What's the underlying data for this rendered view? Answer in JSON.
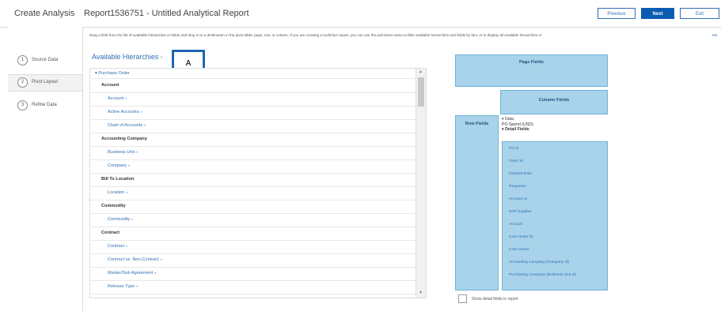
{
  "header": {
    "app_title": "Create Analysis",
    "report_title": "Report1536751 - Untitled Analytical Report",
    "previous_label": "Previous",
    "next_label": "Next",
    "exit_label": "Exit"
  },
  "steps": [
    {
      "num": "1",
      "label": "Source Data"
    },
    {
      "num": "2",
      "label": "Pivot Layout"
    },
    {
      "num": "3",
      "label": "Refine Data"
    }
  ],
  "instructions": {
    "text": "Drag a field from the list of available hierarchies or fields and drop it on a destination in the pivot table: page, row, or column. If you are creating a multi-fact report, you can use the pull-down menu to filter available hierarchies and fields by fact, or to display all available hierarchies or",
    "more": "Mo"
  },
  "available": {
    "title": "Available Hierarchies",
    "chevron": "˅",
    "marker": "A",
    "top": "Purchase Order",
    "rows": [
      {
        "type": "group",
        "label": "Account"
      },
      {
        "type": "item",
        "label": "Account"
      },
      {
        "type": "item",
        "label": "Active Accounts"
      },
      {
        "type": "item",
        "label": "Chart of Accounts"
      },
      {
        "type": "group",
        "label": "Accounting Company"
      },
      {
        "type": "item",
        "label": "Business Unit"
      },
      {
        "type": "item",
        "label": "Company"
      },
      {
        "type": "group",
        "label": "Bill To Location"
      },
      {
        "type": "item",
        "label": "Location"
      },
      {
        "type": "group",
        "label": "Commodity"
      },
      {
        "type": "item",
        "label": "Commodity"
      },
      {
        "type": "group",
        "label": "Contract"
      },
      {
        "type": "item",
        "label": "Contract"
      },
      {
        "type": "item",
        "label": "Contract vs. Non-Contract"
      },
      {
        "type": "item",
        "label": "Master/Sub Agreement"
      },
      {
        "type": "item",
        "label": "Release Type"
      }
    ]
  },
  "pivot": {
    "page_fields": "Page Fields",
    "column_fields": "Column Fields",
    "row_fields": "Row Fields",
    "data_label": "Data",
    "data_value": "PO Spend (USD)",
    "detail_label": "Detail Fields",
    "detail_fields": [
      "PO Id",
      "Order Id",
      "Ordered Date",
      "Requester",
      "Account Id",
      "ERP Supplier",
      "Account",
      "Cost center ID",
      "Cost Center",
      "Accounting Company (Company Id)",
      "Purchasing Company (Business Unit Id)"
    ],
    "show_detail": "Show detail fields in report"
  },
  "colors": {
    "accent": "#0a5cb3",
    "field_box": "#a8d3ea",
    "marker_border": "#1f66b4"
  }
}
